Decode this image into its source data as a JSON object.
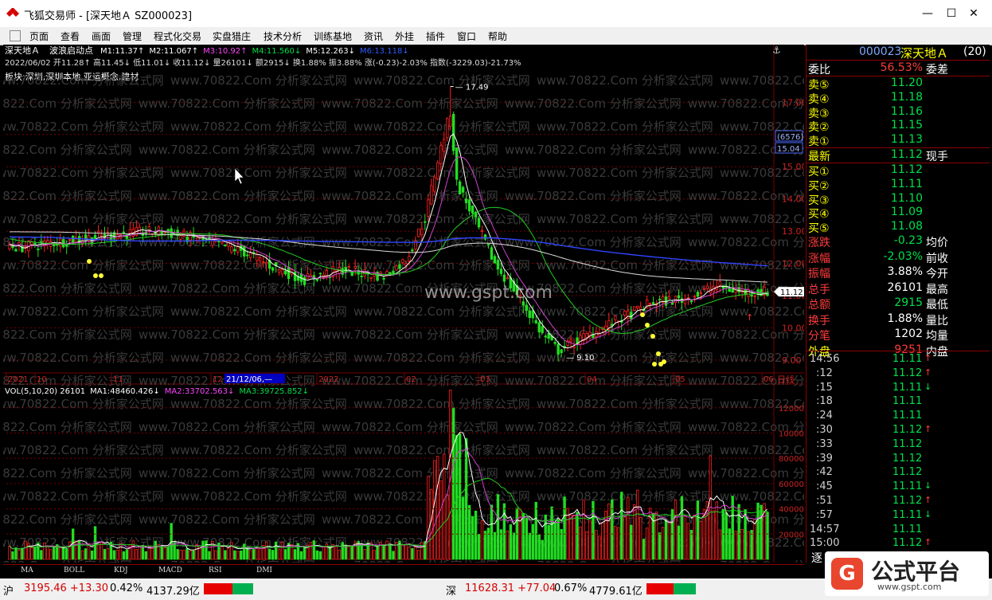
{
  "window": {
    "title": "飞狐交易师 - [深天地Ａ SZ000023]",
    "minimize": "—",
    "maximize": "☐",
    "close": "✕"
  },
  "menu": [
    "页面",
    "查看",
    "画面",
    "管理",
    "程式化交易",
    "实盘猎庄",
    "技术分析",
    "训练基地",
    "资讯",
    "外挂",
    "插件",
    "窗口",
    "帮助"
  ],
  "header": {
    "line1": {
      "name": "深天地Ａ",
      "indicator": "波浪启动点",
      "ma": [
        {
          "label": "M1:11.37",
          "arrow": "↑",
          "color": "#ffffff"
        },
        {
          "label": "M2:11.067",
          "arrow": "↑",
          "color": "#ffffff"
        },
        {
          "label": "M3:10.92",
          "arrow": "↑",
          "color": "#ff44ff"
        },
        {
          "label": "M4:11.560",
          "arrow": "↓",
          "color": "#00e04a"
        },
        {
          "label": "M5:12.263",
          "arrow": "↓",
          "color": "#ffffff"
        },
        {
          "label": "M6:13.118",
          "arrow": "↓",
          "color": "#2f5cff"
        }
      ]
    },
    "line2": "2022/06/02  开11.28↑ 高11.45↓ 低11.01↓ 收11.12↓ 量26101↓ 额2915↓ 换1.88% 振3.88% 涨(-0.23)-2.03% 指数(-3229.03)-21.73%",
    "line3": "板块:深圳,深圳本地,亚运概念,建材"
  },
  "chart_data": {
    "type": "candlestick",
    "price_axis": {
      "min": 8.7,
      "max": 17.8,
      "ticks": [
        "17.00",
        "16.00",
        "15.00",
        "14.00",
        "13.00",
        "12.00",
        "11.00",
        "10.00",
        "9.00"
      ]
    },
    "annotations": {
      "high": "17.49",
      "low": "9.10",
      "last_price": "11.12",
      "tag_count": "(6576)",
      "tag_price": "15.04"
    },
    "date_axis": [
      "2021",
      "10",
      "11",
      "12",
      "21/12/06,—",
      "2022",
      "02",
      "03",
      "04",
      "05",
      "06"
    ],
    "date_axis_tail": "日线",
    "volume_header": {
      "label": "VOL(5,10,20)",
      "value": "26101",
      "ma": [
        {
          "label": "MA1:48460.426",
          "arrow": "↓",
          "color": "#ffffff"
        },
        {
          "label": "MA2:33702.563",
          "arrow": "↓",
          "color": "#ff44ff"
        },
        {
          "label": "MA3:39725.852",
          "arrow": "↓",
          "color": "#00e04a"
        }
      ]
    },
    "volume_axis": {
      "max": 135000,
      "ticks": [
        "120000",
        "100000",
        "80000",
        "60000",
        "40000",
        "20000"
      ]
    },
    "colors": {
      "up": "#ff2020",
      "down": "#22dd22",
      "ma_white": "#ffffff",
      "ma_magenta": "#cc44cc",
      "ma_green": "#22cc22",
      "ma_blue": "#2f45ff",
      "grid": "#7a0000"
    }
  },
  "watermark": {
    "text": "www.70822.Com 分析家公式网",
    "site": "www.gspt.com"
  },
  "bottom_tabs": [
    "MA",
    "BOLL",
    "KDJ",
    "MACD",
    "RSI",
    "DMI"
  ],
  "sidebar": {
    "code": "000023",
    "name": "深天地Ａ",
    "num": "(20)",
    "weibi": {
      "label": "委比",
      "value": "56.53%",
      "label2": "委差"
    },
    "sells": [
      {
        "label": "卖⑤",
        "price": "11.20"
      },
      {
        "label": "卖④",
        "price": "11.18"
      },
      {
        "label": "卖③",
        "price": "11.16"
      },
      {
        "label": "卖②",
        "price": "11.15"
      },
      {
        "label": "卖①",
        "price": "11.13"
      }
    ],
    "latest": {
      "label": "最新",
      "price": "11.12",
      "label2": "现手"
    },
    "buys": [
      {
        "label": "买①",
        "price": "11.12"
      },
      {
        "label": "买②",
        "price": "11.11"
      },
      {
        "label": "买③",
        "price": "11.10"
      },
      {
        "label": "买④",
        "price": "11.09"
      },
      {
        "label": "买⑤",
        "price": "11.08"
      }
    ],
    "stats": [
      {
        "label": "涨跌",
        "value": "-0.23",
        "label2": "均价"
      },
      {
        "label": "涨幅",
        "value": "-2.03%",
        "label2": "前收"
      },
      {
        "label": "振幅",
        "value": "3.88%",
        "label2": "今开"
      },
      {
        "label": "总手",
        "value": "26101",
        "label2": "最高"
      },
      {
        "label": "总额",
        "value": "2915",
        "label2": "最低"
      },
      {
        "label": "换手",
        "value": "1.88%",
        "label2": "量比"
      },
      {
        "label": "分笔",
        "value": "1202",
        "label2": "均量"
      },
      {
        "label": "外盘",
        "value": "9251",
        "label2": "内盘"
      }
    ],
    "ticks": [
      {
        "time": "14:56",
        "price": "11.11",
        "arrow": "↑"
      },
      {
        "time": ":12",
        "price": "11.12",
        "arrow": "↑"
      },
      {
        "time": ":15",
        "price": "11.11",
        "arrow": "↓"
      },
      {
        "time": ":18",
        "price": "11.11",
        "arrow": ""
      },
      {
        "time": ":24",
        "price": "11.11",
        "arrow": ""
      },
      {
        "time": ":30",
        "price": "11.12",
        "arrow": "↑"
      },
      {
        "time": ":33",
        "price": "11.12",
        "arrow": ""
      },
      {
        "time": ":39",
        "price": "11.12",
        "arrow": ""
      },
      {
        "time": ":42",
        "price": "11.12",
        "arrow": ""
      },
      {
        "time": ":45",
        "price": "11.11",
        "arrow": "↓"
      },
      {
        "time": ":51",
        "price": "11.12",
        "arrow": "↑"
      },
      {
        "time": ":57",
        "price": "11.11",
        "arrow": "↓"
      },
      {
        "time": "14:57",
        "price": "11.11",
        "arrow": ""
      },
      {
        "time": "15:00",
        "price": "11.12",
        "arrow": "↑"
      }
    ],
    "bottom_label": "逐"
  },
  "status": {
    "sh_label": "沪",
    "sh": "3195.46 +13.30",
    "sh_pct": "0.42%",
    "sh_amt": "4137.29亿",
    "sz_label": "深",
    "sz": "11628.31 +77.04",
    "sz_pct": "0.67%",
    "sz_amt": "4779.61亿"
  },
  "brand": {
    "name": "公式平台",
    "url": "www.gspt.com"
  }
}
